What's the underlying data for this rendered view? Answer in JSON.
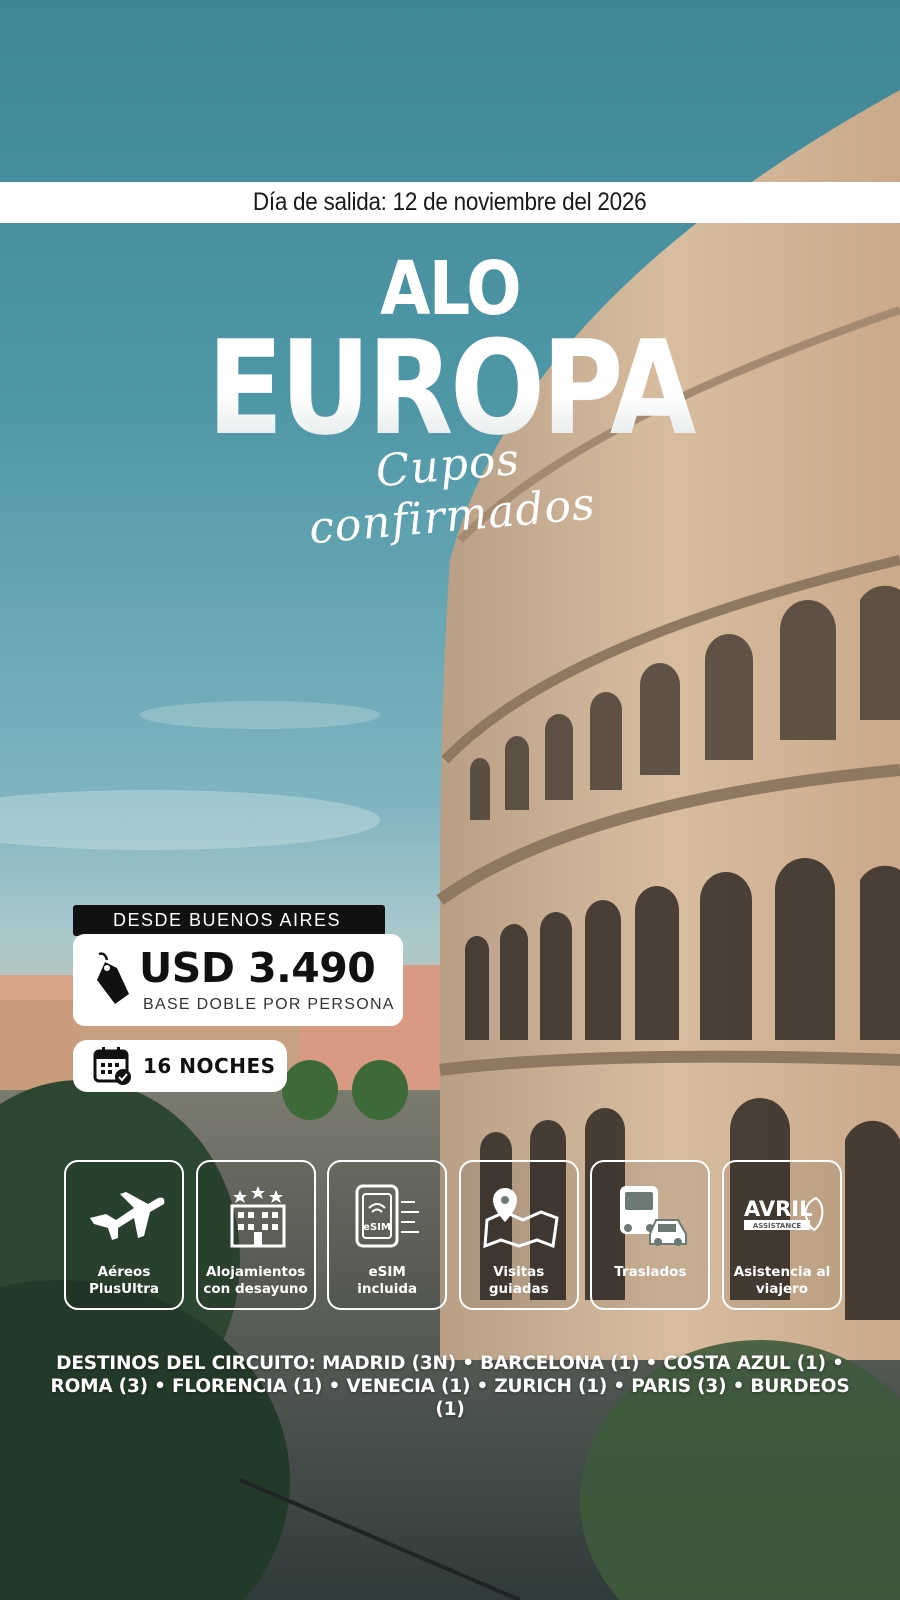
{
  "departure": {
    "text": "Día de salida: 12 de noviembre del 2026"
  },
  "title": {
    "line1": "ALO",
    "line2": "EUROPA",
    "subtitle": "Cupos confirmados"
  },
  "pricing": {
    "origin": "DESDE BUENOS AIRES",
    "price": "USD 3.490",
    "basis": "BASE DOBLE POR PERSONA",
    "tag_icon": "price-tag-icon"
  },
  "duration": {
    "nights": "16 NOCHES",
    "icon": "calendar-check-icon"
  },
  "features": [
    {
      "icon": "airplane-icon",
      "label": "Aéreos\nPlusUltra"
    },
    {
      "icon": "hotel-icon",
      "label": "Alojamientos\ncon desayuno"
    },
    {
      "icon": "esim-icon",
      "label": "eSIM\nincluida",
      "icon_text": "eSIM"
    },
    {
      "icon": "map-pin-icon",
      "label": "Visitas\nguiadas"
    },
    {
      "icon": "bus-car-icon",
      "label": "Traslados"
    },
    {
      "icon": "avril-logo",
      "label": "Asistencia al\nviajero",
      "logo_text": "AVRIL",
      "logo_subtext": "ASSISTANCE"
    }
  ],
  "destinations": {
    "line1": "DESTINOS DEL CIRCUITO: MADRID (3N) • BARCELONA (1) • COSTA AZUL (1) •",
    "line2": "ROMA (3) • FLORENCIA (1) • VENECIA (1) • ZURICH (1) • PARIS (3) • BURDEOS (1)"
  },
  "colors": {
    "sky": "#4e97a6",
    "stone": "#c9ad8f",
    "white": "#ffffff",
    "dark": "#111111"
  }
}
